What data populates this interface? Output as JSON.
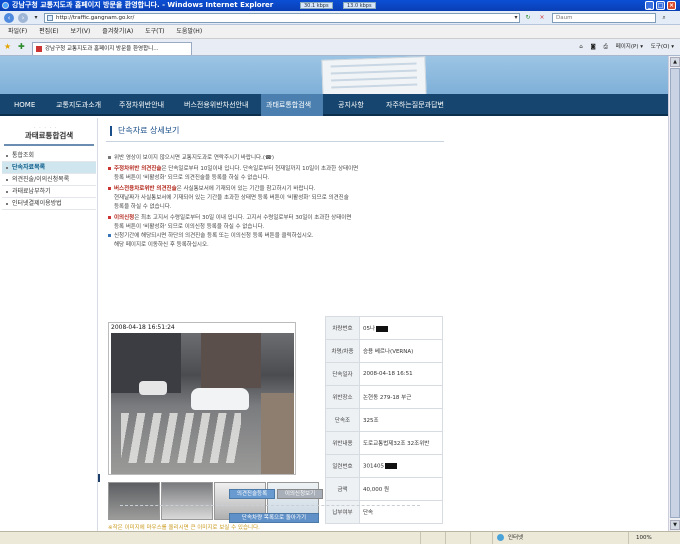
{
  "window": {
    "title": "강남구청 교통지도과 홈페이지 방문을 환영합니다. - Windows Internet Explorer",
    "speed_down": "30.1 kbps",
    "speed_up": "13.0 kbps"
  },
  "address_bar": {
    "url": "http://traffic.gangnam.go.kr/",
    "search_placeholder": "Daum"
  },
  "menu": {
    "items": [
      "파일(F)",
      "편집(E)",
      "보기(V)",
      "즐겨찾기(A)",
      "도구(T)",
      "도움말(H)"
    ]
  },
  "tabs": {
    "active_tab": "강남구청 교통지도과 홈페이지 방문을 환영합니..."
  },
  "toolbar": {
    "page_label": "페이지(P) ▾",
    "tools_label": "도구(O) ▾"
  },
  "nav": {
    "items": [
      "HOME",
      "교통지도과소개",
      "주정차위반안내",
      "버스전용위반차선안내",
      "과태료통합검색",
      "공지사항",
      "자주하는질문과답변"
    ]
  },
  "sidebar": {
    "title": "과태료통합검색",
    "items": [
      "통합조회",
      "단속자료목록",
      "의견진술/이의신청목록",
      "과태료납부하기",
      "인터넷결제이용방법"
    ]
  },
  "content": {
    "title": "단속자료 상세보기",
    "notices": [
      {
        "bold": "",
        "text": "위반 영상이 보이지 않으시면 교통지도과로 연락주시기 바랍니다.(☎)"
      },
      {
        "bold": "주정차위반 의견진술",
        "text": "은 단속일로부터 10일이내 입니다. 단속일로부터 현재일까지 10일이 초과한 상태이면"
      },
      {
        "bold": "",
        "text": "등록 버튼이 '비활성화' 되므로 의견진술을 등록을 하실 수 없습니다."
      },
      {
        "bold": "버스전용차로위반 의견진술",
        "text": "은 사실통보서에 기재되어 있는 기간을 참고하시기 바랍니다."
      },
      {
        "bold": "",
        "text": "현재날짜가 사실통보서에 기재되어 있는 기간을 초과한 상태면 등록 버튼이 '비활성화' 되므로 의견진술"
      },
      {
        "bold": "",
        "text": "등록을 하실 수 없습니다."
      },
      {
        "bold": "이의신청",
        "text": "은 최초 고지서 수령일로부터 30일 이내 입니다. 고지서 수령일로부터 30일이 초과한 상태이면"
      },
      {
        "bold": "",
        "text": "등록 버튼이 '비활성화' 되므로 이의신청 등록을 하실 수 없습니다."
      },
      {
        "bold": "",
        "text": "신청기간에 해당되시면 하단의 의견진술 등록 또는 이의신청 등록 버튼을 클릭하십시오."
      },
      {
        "bold": "",
        "text": "해당 페이지로 이동하신 후 등록하십시오."
      }
    ],
    "photo_timestamp": "2008-04-18 16:51:24",
    "thumb_note": "※작은 이미지에 마우스를 올리시면 큰 이미지로 보실 수 있습니다.",
    "buttons": {
      "opinion": "의견진술등록",
      "objection": "이의신청보기",
      "back": "단속차량 목록으로 돌아가기"
    }
  },
  "info": {
    "rows": [
      {
        "label": "차량번호",
        "value": "05나"
      },
      {
        "label": "차명/차종",
        "value": "승용 베르나(VERNA)"
      },
      {
        "label": "단속일자",
        "value": "2008-04-18 16:51"
      },
      {
        "label": "위반장소",
        "value": "논현동 279-18 부근"
      },
      {
        "label": "단속조",
        "value": "325조"
      },
      {
        "label": "위반내용",
        "value": "도로교통법제32조 32조위반"
      },
      {
        "label": "일련번호",
        "value": "301405"
      },
      {
        "label": "금액",
        "value": "40,000 원"
      },
      {
        "label": "납부여부",
        "value": "단속"
      }
    ]
  },
  "status_bar": {
    "zone": "인터넷",
    "zoom": "100%"
  }
}
